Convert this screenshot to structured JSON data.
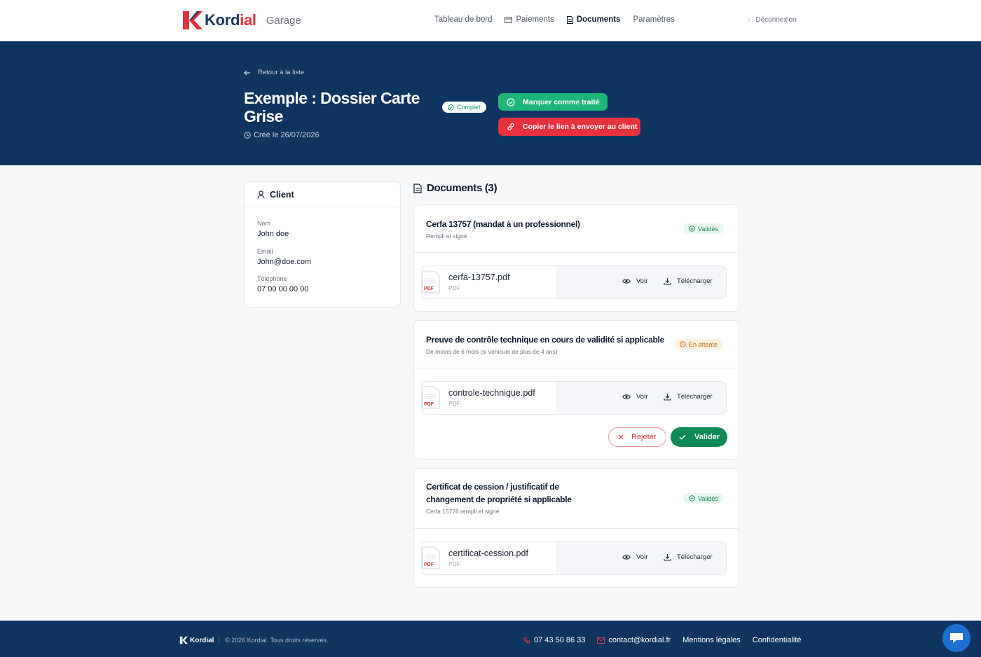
{
  "brand": {
    "name_main": "Kord",
    "name_accent": "ial",
    "subtitle": "Garage",
    "accent_color": "#e1323c",
    "primary_color": "#0f3460"
  },
  "nav": {
    "links": [
      {
        "label": "Tableau de bord",
        "icon": null
      },
      {
        "label": "Paiements",
        "icon": "card-icon"
      },
      {
        "label": "Documents",
        "icon": "document-icon",
        "active": true
      },
      {
        "label": "Paramètres",
        "icon": null
      }
    ],
    "logout_label": "Déconnexion"
  },
  "hero": {
    "back_label": "Retour à la liste",
    "title": "Exemple : Dossier Carte Grise",
    "created": "Créé le 26/07/2026",
    "status_badge": "Complet",
    "mark_treated_label": "Marquer comme traité",
    "copy_link_label": "Copier le lien à envoyer au client"
  },
  "client": {
    "heading": "Client",
    "fields": [
      {
        "label": "Nom",
        "value": "John doe"
      },
      {
        "label": "Email",
        "value": "John@doe.com"
      },
      {
        "label": "Téléphone",
        "value": "07 00 00 00 00"
      }
    ]
  },
  "documents": {
    "heading": "Documents (3)",
    "items": [
      {
        "title": "Cerfa 13757 (mandat à un professionnel)",
        "subtitle": "Rempli et signé",
        "status": "Validés",
        "status_kind": "ok",
        "file_name": "cerfa-13757.pdf",
        "file_type": "PDF",
        "view_label": "Voir",
        "download_label": "Télécharger"
      },
      {
        "title": "Preuve de contrôle technique en cours de validité si applicable",
        "subtitle": "De moins de 6 mois (si véhicule de plus de 4 ans)",
        "status": "En attente",
        "status_kind": "wait",
        "file_name": "controle-technique.pdf",
        "file_type": "PDF",
        "view_label": "Voir",
        "download_label": "Télécharger",
        "reject_label": "Rejeter",
        "validate_label": "Valider"
      },
      {
        "title_line1": "Certificat de cession / justificatif de",
        "title_line2": "changement de propriété si applicable",
        "subtitle": "Cerfa 15776 rempli et signé",
        "status": "Validés",
        "status_kind": "ok",
        "file_name": "certificat-cession.pdf",
        "file_type": "PDF",
        "view_label": "Voir",
        "download_label": "Télécharger"
      }
    ]
  },
  "pdf_badge": "PDF",
  "footer": {
    "brand": "Kordial",
    "copyright": "© 2026 Kordial. Tous droits réservés.",
    "phone": "07 43 50 86 33",
    "email": "contact@kordial.fr",
    "legal": "Mentions légales",
    "privacy": "Confidentialité"
  }
}
